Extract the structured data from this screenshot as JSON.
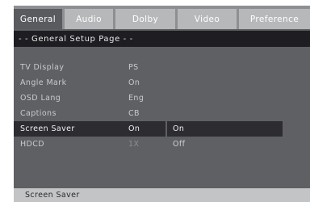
{
  "tabs": [
    "General",
    "Audio",
    "Dolby",
    "Video",
    "Preference"
  ],
  "active_tab": 0,
  "page_header": "- - General Setup Page - -",
  "settings": [
    {
      "label": "TV Display",
      "value": "PS"
    },
    {
      "label": "Angle Mark",
      "value": "On"
    },
    {
      "label": "OSD Lang",
      "value": "Eng"
    },
    {
      "label": "Captions",
      "value": "CB"
    },
    {
      "label": "Screen Saver",
      "value": "On"
    },
    {
      "label": "HDCD",
      "value": "1X"
    }
  ],
  "highlighted_setting": 4,
  "options": [
    "On",
    "Off"
  ],
  "selected_option": 0,
  "status_text": "Screen Saver",
  "colors": {
    "background": "#5f6063",
    "tab_bar": "#8e8f92",
    "tab": "#b7b8ba",
    "tab_active": "#5a5b5e",
    "header": "#1e1e22",
    "highlight": "#2c2c31",
    "status_bar": "#c3c4c6"
  }
}
